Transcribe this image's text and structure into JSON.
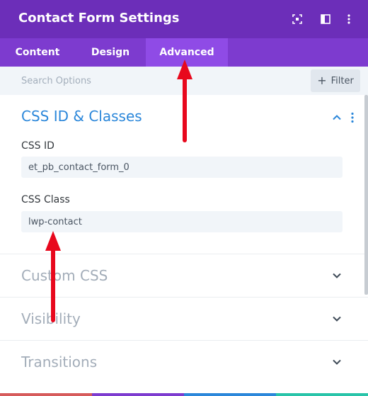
{
  "header": {
    "title": "Contact Form Settings",
    "icons": [
      "focus-icon",
      "split-view-icon",
      "more-vertical-icon"
    ],
    "background": "#6c2eb9"
  },
  "tabs": [
    {
      "label": "Content",
      "active": false
    },
    {
      "label": "Design",
      "active": false
    },
    {
      "label": "Advanced",
      "active": true
    }
  ],
  "search": {
    "placeholder": "Search Options",
    "filter_label": "Filter"
  },
  "sections": {
    "css_id_classes": {
      "title": "CSS ID & Classes",
      "expanded": true,
      "fields": {
        "css_id": {
          "label": "CSS ID",
          "value": "et_pb_contact_form_0"
        },
        "css_class": {
          "label": "CSS Class",
          "value": "lwp-contact"
        }
      }
    },
    "custom_css": {
      "title": "Custom CSS",
      "expanded": false
    },
    "visibility": {
      "title": "Visibility",
      "expanded": false
    },
    "transitions": {
      "title": "Transitions",
      "expanded": false
    }
  },
  "colors": {
    "accent": "#2b87da",
    "annotation_arrow": "#e8081d",
    "tab_active": "#8f4be6",
    "footer": [
      "#d65b5b",
      "#7d3bcf",
      "#2b87da",
      "#29c4a9"
    ]
  }
}
